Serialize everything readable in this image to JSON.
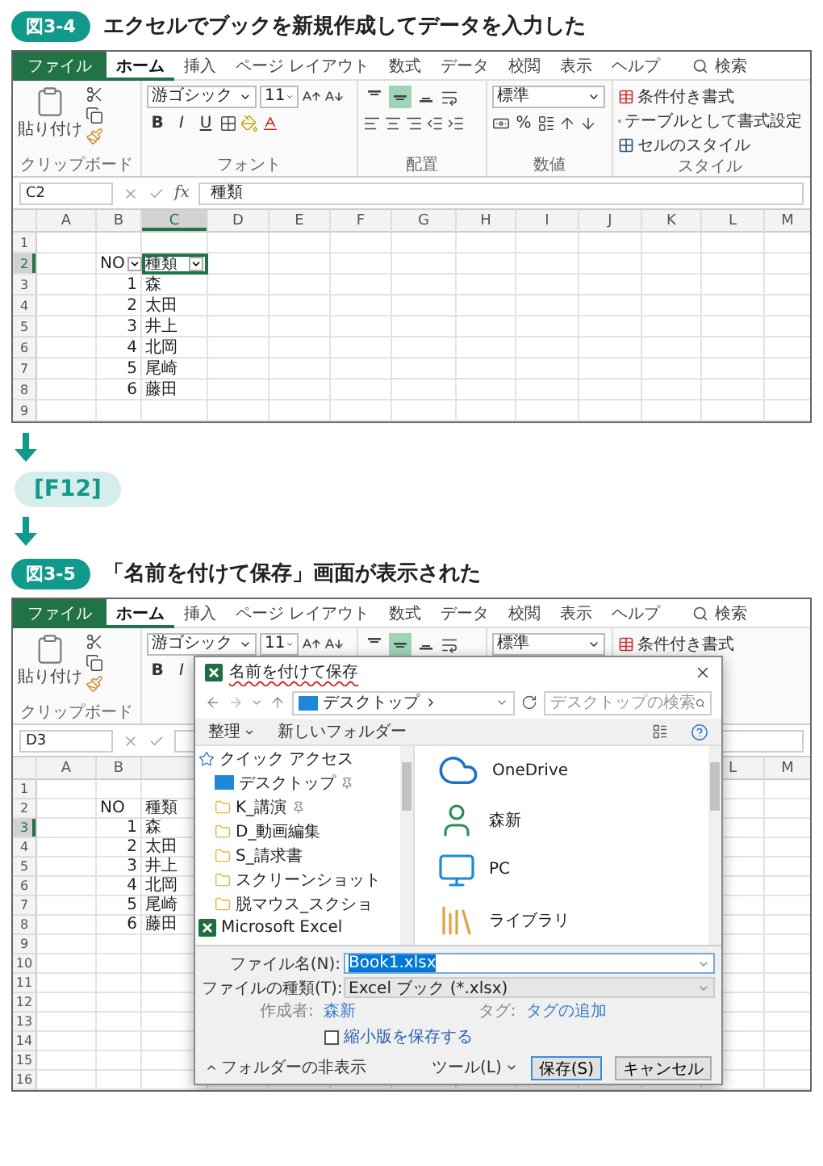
{
  "figure_1": {
    "badge": "図3-4",
    "caption": "エクセルでブックを新規作成してデータを入力した",
    "excel": {
      "tabs": [
        {
          "label": "ファイル",
          "kind": "file",
          "selected": false
        },
        {
          "label": "ホーム",
          "kind": "tab",
          "selected": true
        },
        {
          "label": "挿入",
          "kind": "tab",
          "selected": false
        },
        {
          "label": "ページ レイアウト",
          "kind": "tab",
          "selected": false
        },
        {
          "label": "数式",
          "kind": "tab",
          "selected": false
        },
        {
          "label": "データ",
          "kind": "tab",
          "selected": false
        },
        {
          "label": "校閲",
          "kind": "tab",
          "selected": false
        },
        {
          "label": "表示",
          "kind": "tab",
          "selected": false
        },
        {
          "label": "ヘルプ",
          "kind": "tab",
          "selected": false
        }
      ],
      "search": "検索",
      "ribbon": {
        "paste_label": "貼り付け",
        "clipboard_label": "クリップボード",
        "font_name": "游ゴシック",
        "font_size": "11",
        "font_buttons": [
          "B",
          "I",
          "U"
        ],
        "font_label": "フォント",
        "vertical_align": [
          {
            "selected": false
          },
          {
            "selected": true
          },
          {
            "selected": false
          }
        ],
        "align_label": "配置",
        "number_format": "標準",
        "percent": "%",
        "number_label": "数値",
        "styles": [
          "条件付き書式",
          "テーブルとして書式設定",
          "セルのスタイル"
        ],
        "styles_label": "スタイル"
      },
      "name_box": "C2",
      "function_symbol": "fx",
      "formula": "種類",
      "grid": {
        "columns": [
          {
            "label": "A",
            "selected": false
          },
          {
            "label": "B",
            "selected": false
          },
          {
            "label": "C",
            "selected": true
          },
          {
            "label": "D",
            "selected": false
          },
          {
            "label": "E",
            "selected": false
          },
          {
            "label": "F",
            "selected": false
          },
          {
            "label": "G",
            "selected": false
          },
          {
            "label": "H",
            "selected": false
          },
          {
            "label": "I",
            "selected": false
          },
          {
            "label": "J",
            "selected": false
          },
          {
            "label": "K",
            "selected": false
          },
          {
            "label": "L",
            "selected": false
          },
          {
            "label": "M",
            "selected": false
          }
        ],
        "rows": [
          {
            "label": "1",
            "selected": false
          },
          {
            "label": "2",
            "selected": true,
            "filter": true,
            "b": {
              "text": "NO",
              "kind": "text"
            },
            "c": {
              "text": "種類",
              "kind": "text",
              "selected": true
            }
          },
          {
            "label": "3",
            "selected": false,
            "b": {
              "text": "1",
              "kind": "number"
            },
            "c": {
              "text": "森",
              "kind": "text",
              "selected": false
            }
          },
          {
            "label": "4",
            "selected": false,
            "b": {
              "text": "2",
              "kind": "number"
            },
            "c": {
              "text": "太田",
              "kind": "text",
              "selected": false
            }
          },
          {
            "label": "5",
            "selected": false,
            "b": {
              "text": "3",
              "kind": "number"
            },
            "c": {
              "text": "井上",
              "kind": "text",
              "selected": false
            }
          },
          {
            "label": "6",
            "selected": false,
            "b": {
              "text": "4",
              "kind": "number"
            },
            "c": {
              "text": "北岡",
              "kind": "text",
              "selected": false
            }
          },
          {
            "label": "7",
            "selected": false,
            "b": {
              "text": "5",
              "kind": "number"
            },
            "c": {
              "text": "尾崎",
              "kind": "text",
              "selected": false
            }
          },
          {
            "label": "8",
            "selected": false,
            "b": {
              "text": "6",
              "kind": "number"
            },
            "c": {
              "text": "藤田",
              "kind": "text",
              "selected": false
            }
          },
          {
            "label": "9",
            "selected": false
          }
        ]
      }
    }
  },
  "step": {
    "key": "[F12]"
  },
  "figure_2": {
    "badge": "図3-5",
    "caption": "「名前を付けて保存」画面が表示された",
    "excel": {
      "tabs": [
        {
          "label": "ファイル",
          "kind": "file",
          "selected": false
        },
        {
          "label": "ホーム",
          "kind": "tab",
          "selected": true
        },
        {
          "label": "挿入",
          "kind": "tab",
          "selected": false
        },
        {
          "label": "ページ レイアウト",
          "kind": "tab",
          "selected": false
        },
        {
          "label": "数式",
          "kind": "tab",
          "selected": false
        },
        {
          "label": "データ",
          "kind": "tab",
          "selected": false
        },
        {
          "label": "校閲",
          "kind": "tab",
          "selected": false
        },
        {
          "label": "表示",
          "kind": "tab",
          "selected": false
        },
        {
          "label": "ヘルプ",
          "kind": "tab",
          "selected": false
        }
      ],
      "search": "検索",
      "ribbon": {
        "paste_label": "貼り付け",
        "clipboard_label": "クリップボード",
        "font_name": "游ゴシック",
        "font_size": "11",
        "font_buttons": [
          "B",
          "I"
        ],
        "vertical_align": [
          {
            "selected": false
          },
          {
            "selected": true
          },
          {
            "selected": false
          }
        ],
        "number_format": "標準",
        "styles": [
          "条件付き書式"
        ]
      },
      "name_box": "D3",
      "grid": {
        "columns_left": [
          {
            "label": "A",
            "selected": false
          },
          {
            "label": "B",
            "selected": false
          }
        ],
        "columns_right": [
          {
            "label": "L",
            "selected": false
          },
          {
            "label": "M",
            "selected": false
          }
        ],
        "rows": [
          {
            "label": "1",
            "selected": false
          },
          {
            "label": "2",
            "selected": false,
            "b": {
              "text": "NO",
              "kind": "text"
            },
            "c": {
              "text": "種類",
              "kind": "text",
              "selected": false
            }
          },
          {
            "label": "3",
            "selected": true,
            "b": {
              "text": "1",
              "kind": "number"
            },
            "c": {
              "text": "森",
              "kind": "text",
              "selected": false
            }
          },
          {
            "label": "4",
            "selected": false,
            "b": {
              "text": "2",
              "kind": "number"
            },
            "c": {
              "text": "太田",
              "kind": "text",
              "selected": false
            }
          },
          {
            "label": "5",
            "selected": false,
            "b": {
              "text": "3",
              "kind": "number"
            },
            "c": {
              "text": "井上",
              "kind": "text",
              "selected": false
            }
          },
          {
            "label": "6",
            "selected": false,
            "b": {
              "text": "4",
              "kind": "number"
            },
            "c": {
              "text": "北岡",
              "kind": "text",
              "selected": false
            }
          },
          {
            "label": "7",
            "selected": false,
            "b": {
              "text": "5",
              "kind": "number"
            },
            "c": {
              "text": "尾崎",
              "kind": "text",
              "selected": false
            }
          },
          {
            "label": "8",
            "selected": false,
            "b": {
              "text": "6",
              "kind": "number"
            },
            "c": {
              "text": "藤田",
              "kind": "text",
              "selected": false
            }
          },
          {
            "label": "9",
            "selected": false
          },
          {
            "label": "10",
            "selected": false
          },
          {
            "label": "11",
            "selected": false
          },
          {
            "label": "12",
            "selected": false
          },
          {
            "label": "13",
            "selected": false
          },
          {
            "label": "14",
            "selected": false
          },
          {
            "label": "15",
            "selected": false
          },
          {
            "label": "16",
            "selected": false
          }
        ]
      }
    },
    "dialog": {
      "title": "名前を付けて保存",
      "address": "デスクトップ",
      "search_placeholder": "デスクトップの検索",
      "organize": "整理",
      "new_folder": "新しいフォルダー",
      "tree": [
        {
          "label": "クイック アクセス",
          "kind": "quick",
          "children": [
            {
              "label": "デスクトップ",
              "kind": "desktop",
              "pinned": true
            },
            {
              "label": "K_講演",
              "kind": "folder",
              "pinned": true
            },
            {
              "label": "D_動画編集",
              "kind": "folder",
              "pinned": false
            },
            {
              "label": "S_請求書",
              "kind": "folder",
              "pinned": false
            },
            {
              "label": "スクリーンショット",
              "kind": "folder",
              "pinned": false
            },
            {
              "label": "脱マウス_スクショ",
              "kind": "folder",
              "pinned": false
            }
          ]
        },
        {
          "label": "Microsoft Excel",
          "kind": "excel"
        }
      ],
      "items": [
        {
          "label": "OneDrive",
          "kind": "cloud"
        },
        {
          "label": "森新",
          "kind": "user"
        },
        {
          "label": "PC",
          "kind": "pc"
        },
        {
          "label": "ライブラリ",
          "kind": "library"
        }
      ],
      "file_name_label": "ファイル名(N):",
      "file_name": "Book1.xlsx",
      "file_type_label": "ファイルの種類(T):",
      "file_type": "Excel ブック (*.xlsx)",
      "author_label": "作成者:",
      "author": "森新",
      "tags_label": "タグ:",
      "tags": "タグの追加",
      "thumbnail": {
        "label": "縮小版を保存する",
        "checked": false
      },
      "hide_folders": "フォルダーの非表示",
      "tools": "ツール(L)",
      "save": "保存(S)",
      "cancel": "キャンセル"
    }
  }
}
